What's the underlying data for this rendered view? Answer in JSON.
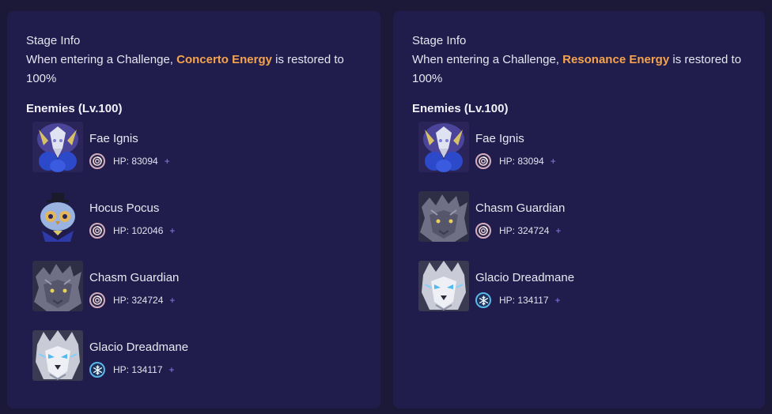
{
  "panels": [
    {
      "stage_title": "Stage Info",
      "desc_prefix": "When entering a Challenge, ",
      "desc_highlight": "Concerto Energy",
      "desc_suffix": " is restored to 100%",
      "enemies_heading": "Enemies (Lv.100)",
      "enemies": [
        {
          "name": "Fae Ignis",
          "hp": "HP: 83094",
          "element": "spectro",
          "portrait": "fae-ignis"
        },
        {
          "name": "Hocus Pocus",
          "hp": "HP: 102046",
          "element": "spectro",
          "portrait": "hocus-pocus"
        },
        {
          "name": "Chasm Guardian",
          "hp": "HP: 324724",
          "element": "spectro",
          "portrait": "chasm-guardian"
        },
        {
          "name": "Glacio Dreadmane",
          "hp": "HP: 134117",
          "element": "glacio",
          "portrait": "glacio-dreadmane"
        }
      ]
    },
    {
      "stage_title": "Stage Info",
      "desc_prefix": "When entering a Challenge, ",
      "desc_highlight": "Resonance Energy",
      "desc_suffix": " is restored to 100%",
      "enemies_heading": "Enemies (Lv.100)",
      "enemies": [
        {
          "name": "Fae Ignis",
          "hp": "HP: 83094",
          "element": "spectro",
          "portrait": "fae-ignis"
        },
        {
          "name": "Chasm Guardian",
          "hp": "HP: 324724",
          "element": "spectro",
          "portrait": "chasm-guardian"
        },
        {
          "name": "Glacio Dreadmane",
          "hp": "HP: 134117",
          "element": "glacio",
          "portrait": "glacio-dreadmane"
        }
      ]
    }
  ],
  "plus_symbol": "+",
  "colors": {
    "background": "#1b1838",
    "panel": "#201d4c",
    "highlight": "#f6a34d",
    "spectro_ring": "#d4aebe",
    "glacio_ring": "#58b7ea",
    "plus": "#8a7ef0"
  }
}
